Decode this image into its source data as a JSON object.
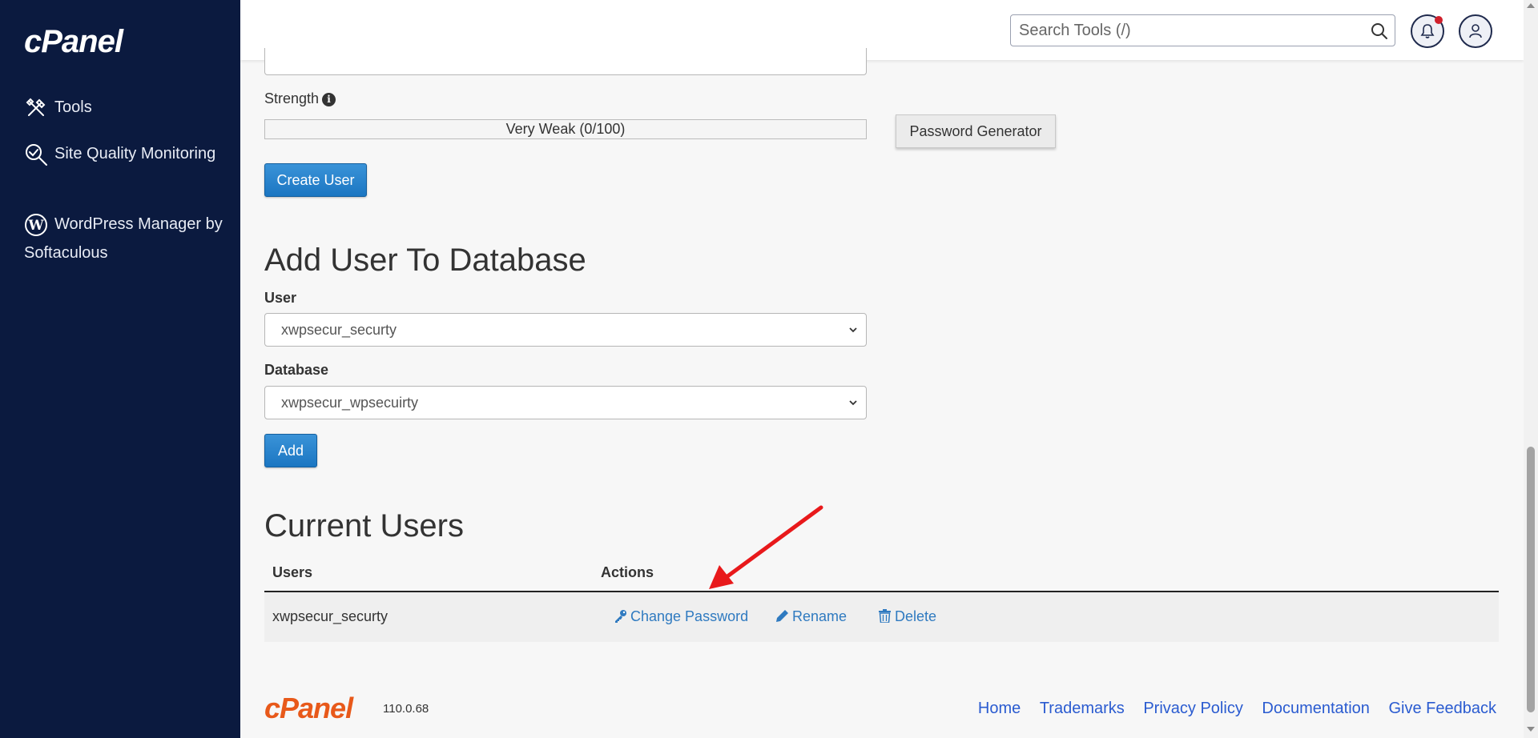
{
  "sidebar": {
    "logo": "cPanel",
    "items": [
      {
        "label": "Tools"
      },
      {
        "label": "Site Quality Monitoring"
      },
      {
        "label": "WordPress Manager by Softaculous"
      }
    ]
  },
  "header": {
    "search_placeholder": "Search Tools (/)"
  },
  "password_section": {
    "strength_label": "Strength",
    "strength_value": "Very Weak (0/100)",
    "strength_percent": 0,
    "generator_label": "Password Generator",
    "create_label": "Create User"
  },
  "add_user_section": {
    "title": "Add User To Database",
    "user_label": "User",
    "user_value": "xwpsecur_securty",
    "database_label": "Database",
    "database_value": "xwpsecur_wpsecuirty",
    "add_label": "Add"
  },
  "current_users": {
    "title": "Current Users",
    "col_users": "Users",
    "col_actions": "Actions",
    "rows": [
      {
        "user": "xwpsecur_securty",
        "change_password": "Change Password",
        "rename": "Rename",
        "delete": "Delete"
      }
    ]
  },
  "footer": {
    "logo": "cPanel",
    "version": "110.0.68",
    "links": [
      "Home",
      "Trademarks",
      "Privacy Policy",
      "Documentation",
      "Give Feedback"
    ]
  },
  "colors": {
    "sidebar_bg": "#0b1a3f",
    "primary_button": "#1a7cc7",
    "link": "#2f7ac0",
    "annotation_arrow": "#e8191b",
    "footer_logo": "#e8591a"
  }
}
